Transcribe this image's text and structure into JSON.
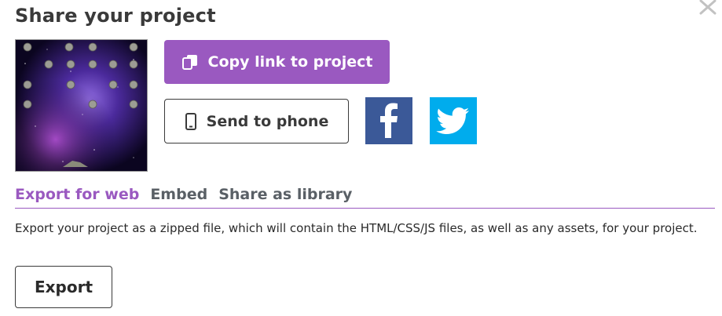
{
  "dialog": {
    "title": "Share your project",
    "close_icon": "close-icon"
  },
  "actions": {
    "copy_link_label": "Copy link to project",
    "copy_icon": "copy-icon",
    "send_to_phone_label": "Send to phone",
    "phone_icon": "phone-icon",
    "facebook_icon": "facebook-icon",
    "twitter_icon": "twitter-icon"
  },
  "tabs": [
    {
      "label": "Export for web",
      "active": true
    },
    {
      "label": "Embed",
      "active": false
    },
    {
      "label": "Share as library",
      "active": false
    }
  ],
  "export": {
    "description": "Export your project as a zipped file, which will contain the HTML/CSS/JS files, as well as any assets, for your project.",
    "button_label": "Export"
  },
  "colors": {
    "accent": "#9a59c0",
    "facebook": "#3b5998",
    "twitter": "#00aced",
    "text": "#3a3a3a"
  }
}
